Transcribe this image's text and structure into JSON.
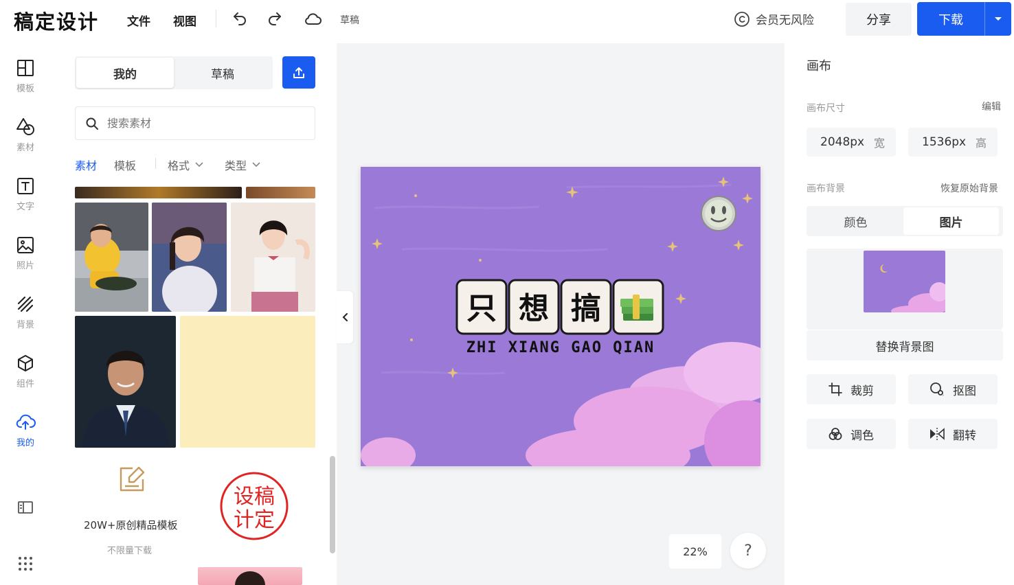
{
  "header": {
    "logo": "稿定设计",
    "menu_file": "文件",
    "menu_view": "视图",
    "draft_status": "草稿",
    "vip_text": "会员无风险",
    "share_label": "分享",
    "download_label": "下载",
    "icons": [
      "undo-icon",
      "redo-icon",
      "cloud-icon",
      "copyright-icon",
      "caret-down-icon"
    ]
  },
  "rail": {
    "items": [
      {
        "label": "模板",
        "icon": "layout-icon"
      },
      {
        "label": "素材",
        "icon": "shapes-icon"
      },
      {
        "label": "文字",
        "icon": "text-icon"
      },
      {
        "label": "照片",
        "icon": "image-icon"
      },
      {
        "label": "背景",
        "icon": "stripes-icon"
      },
      {
        "label": "组件",
        "icon": "cube-icon"
      },
      {
        "label": "我的",
        "icon": "cloud-upload-icon",
        "active": true
      }
    ],
    "extra_icons": [
      "panel-toggle-icon",
      "grid-dots-icon"
    ]
  },
  "panel": {
    "tab_mine": "我的",
    "tab_draft": "草稿",
    "search_placeholder": "搜索素材",
    "filters": {
      "material": "素材",
      "template": "模板",
      "format": "格式",
      "type": "类型"
    },
    "promo": {
      "title": "20W+原创精品模板",
      "subtitle": "不限量下载",
      "stamp_line1": "设稿",
      "stamp_line2": "计定"
    }
  },
  "canvas": {
    "title_chars": [
      "只",
      "想",
      "搞"
    ],
    "subtitle": "ZHI XIANG GAO QIAN",
    "zoom": "22%",
    "help": "?",
    "bg_color": "#9a7ad6"
  },
  "right_panel": {
    "title": "画布",
    "size_label": "画布尺寸",
    "edit_link": "编辑",
    "width_value": "2048px",
    "width_unit": "宽",
    "height_value": "1536px",
    "height_unit": "高",
    "bg_label": "画布背景",
    "restore_link": "恢复原始背景",
    "tab_color": "颜色",
    "tab_image": "图片",
    "replace_label": "替换背景图",
    "tools": {
      "crop": "裁剪",
      "cutout": "抠图",
      "adjust": "调色",
      "flip": "翻转"
    }
  },
  "colors": {
    "accent": "#1b5cf0",
    "canvas_purple": "#9a7ad6",
    "cloud_pink": "#e8a6e6"
  }
}
